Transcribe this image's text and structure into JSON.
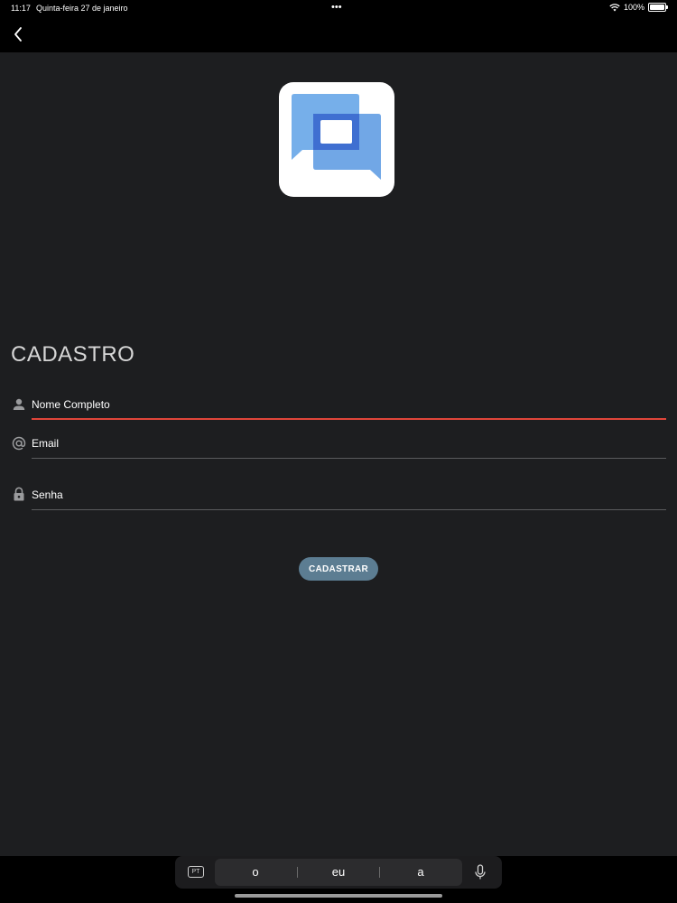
{
  "status_bar": {
    "time": "11:17",
    "date": "Quinta-feira 27 de janeiro",
    "dots": "•••",
    "battery": "100%"
  },
  "page": {
    "title": "CADASTRO"
  },
  "form": {
    "name_label": "Nome Completo",
    "email_label": "Email",
    "password_label": "Senha",
    "submit_label": "CADASTRAR"
  },
  "keyboard": {
    "language": "PT",
    "suggestions": [
      "o",
      "eu",
      "a"
    ]
  },
  "colors": {
    "background": "#1d1e20",
    "active_underline": "#e0463a",
    "button": "#5c7d92",
    "logo_blue_light": "#6aa8e8",
    "logo_blue_dark": "#3f6fd1"
  }
}
